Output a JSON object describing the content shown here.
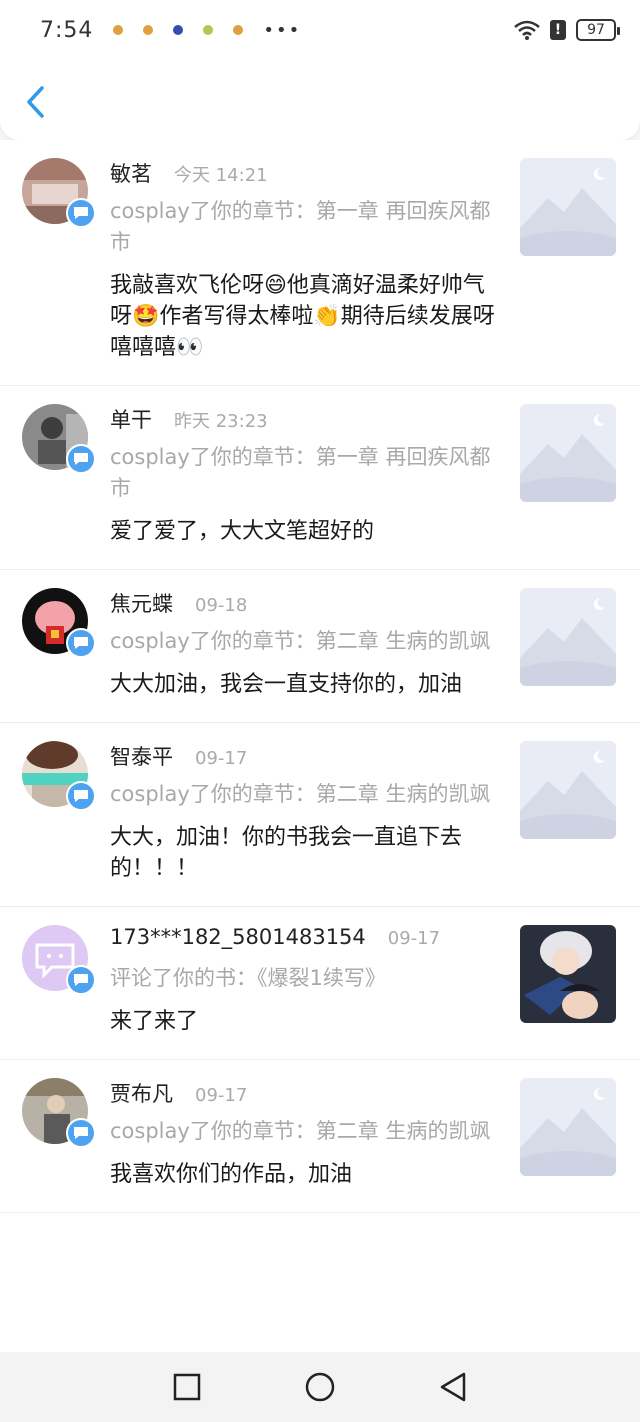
{
  "status_bar": {
    "time": "7:54",
    "battery": "97",
    "more": "•••"
  },
  "items": [
    {
      "name": "敏茗",
      "time": "今天 14:21",
      "action": "cosplay了你的章节：第一章 再回疾风都市",
      "comment": "我敲喜欢飞伦呀😄他真滴好温柔好帅气呀🤩作者写得太棒啦👏期待后续发展呀嘻嘻嘻👀",
      "avatar_color": "#b88f84"
    },
    {
      "name": "单干",
      "time": "昨天 23:23",
      "action": "cosplay了你的章节：第一章 再回疾风都市",
      "comment": "爱了爱了，大大文笔超好的",
      "avatar_color": "#6d6d6d"
    },
    {
      "name": "焦元蝶",
      "time": "09-18",
      "action": "cosplay了你的章节：第二章 生病的凯飒",
      "comment": "大大加油，我会一直支持你的，加油",
      "avatar_color": "#111111"
    },
    {
      "name": "智泰平",
      "time": "09-17",
      "action": "cosplay了你的章节：第二章 生病的凯飒",
      "comment": "大大，加油！你的书我会一直追下去的！！！",
      "avatar_color": "#7a5c4a"
    },
    {
      "name": "173***182_5801483154",
      "time": "09-17",
      "action": "评论了你的书：《爆裂1续写》",
      "comment": "来了来了",
      "avatar_color": "#d9c5f0"
    },
    {
      "name": "贾布凡",
      "time": "09-17",
      "action": "cosplay了你的章节：第二章 生病的凯飒",
      "comment": "我喜欢你们的作品，加油",
      "avatar_color": "#8f8a7e"
    }
  ],
  "colors": {
    "badge": "#4da3f0",
    "back_arrow": "#2f9be8",
    "placeholder_bg": "#e9ecf5"
  }
}
